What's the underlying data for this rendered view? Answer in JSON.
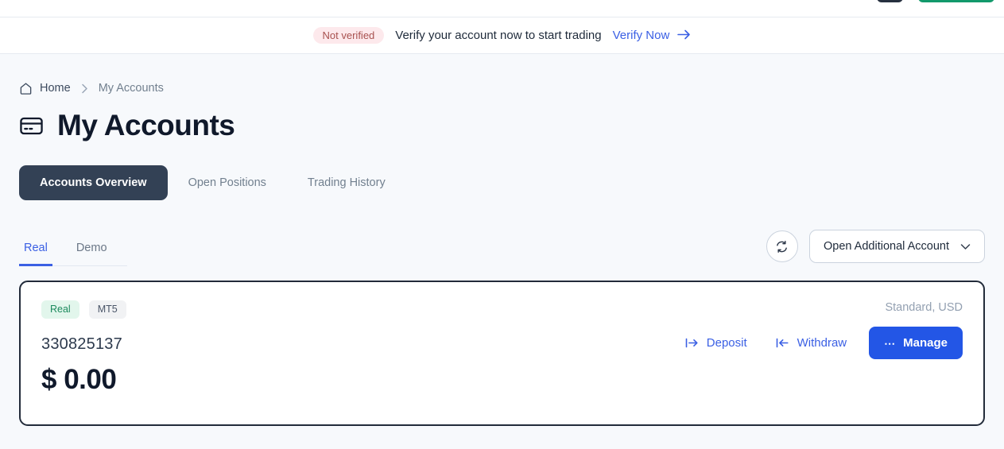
{
  "top_strip": {
    "button_dark_name": "cut-off-dark-button",
    "button_green_name": "cut-off-green-button"
  },
  "banner": {
    "badge": "Not verified",
    "message": "Verify your account now to start trading",
    "link": "Verify Now",
    "arrow": "→",
    "badge_bg": "#fde9ec",
    "badge_color": "#a8514f",
    "link_color": "#3b60e4"
  },
  "breadcrumb": {
    "home": "Home",
    "separator": "›",
    "current": "My Accounts"
  },
  "header": {
    "title": "My Accounts",
    "icon": "credit-card-icon"
  },
  "tabs": [
    {
      "label": "Accounts Overview",
      "active": true
    },
    {
      "label": "Open Positions",
      "active": false
    },
    {
      "label": "Trading History",
      "active": false
    }
  ],
  "subtabs": [
    {
      "label": "Real",
      "active": true
    },
    {
      "label": "Demo",
      "active": false
    }
  ],
  "toolbar": {
    "refresh_icon": "refresh-icon",
    "dropdown_label": "Open Additional Account",
    "dropdown_chevron": "⌄"
  },
  "account": {
    "badges": [
      {
        "label": "Real",
        "type": "real"
      },
      {
        "label": "MT5",
        "type": "platform"
      }
    ],
    "number": "330825137",
    "balance": "$ 0.00",
    "meta": "Standard, USD",
    "actions": [
      {
        "label": "Deposit",
        "icon": "deposit-arrow-icon"
      },
      {
        "label": "Withdraw",
        "icon": "withdraw-arrow-icon"
      }
    ],
    "manage_label": "Manage",
    "manage_icon": "ellipsis-icon",
    "manage_color": "#2356e6"
  }
}
